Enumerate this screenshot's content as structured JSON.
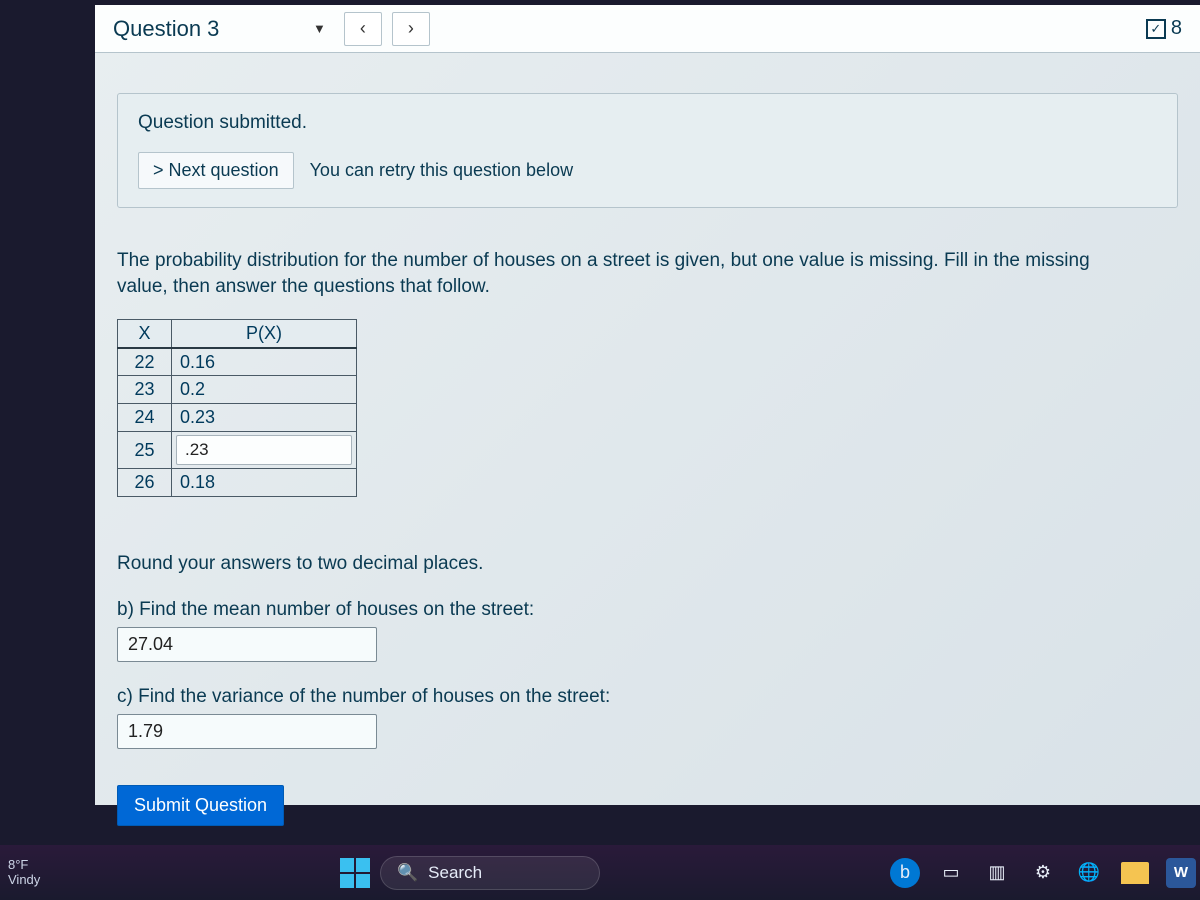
{
  "topbar": {
    "title": "Question 3",
    "prev": "‹",
    "next": "›",
    "points_num": "8"
  },
  "submitted": {
    "label": "Question submitted.",
    "next_btn": "> Next question",
    "retry": "You can retry this question below"
  },
  "prompt": "The probability distribution for the number of houses on a street is given, but one value is missing. Fill in the missing value, then answer the questions that follow.",
  "table": {
    "head_x": "X",
    "head_px": "P(X)",
    "rows": [
      {
        "x": "22",
        "px": "0.16",
        "input": false
      },
      {
        "x": "23",
        "px": "0.2",
        "input": false
      },
      {
        "x": "24",
        "px": "0.23",
        "input": false
      },
      {
        "x": "25",
        "px": ".23",
        "input": true
      },
      {
        "x": "26",
        "px": "0.18",
        "input": false
      }
    ]
  },
  "round_note": "Round your answers to two decimal places.",
  "part_b": {
    "label": "b) Find the mean number of houses on the street:",
    "value": "27.04"
  },
  "part_c": {
    "label": "c) Find the variance of the number of houses on the street:",
    "value": "1.79"
  },
  "submit_label": "Submit Question",
  "taskbar": {
    "temp": "8°F",
    "cond": "Vindy",
    "search": "Search"
  }
}
